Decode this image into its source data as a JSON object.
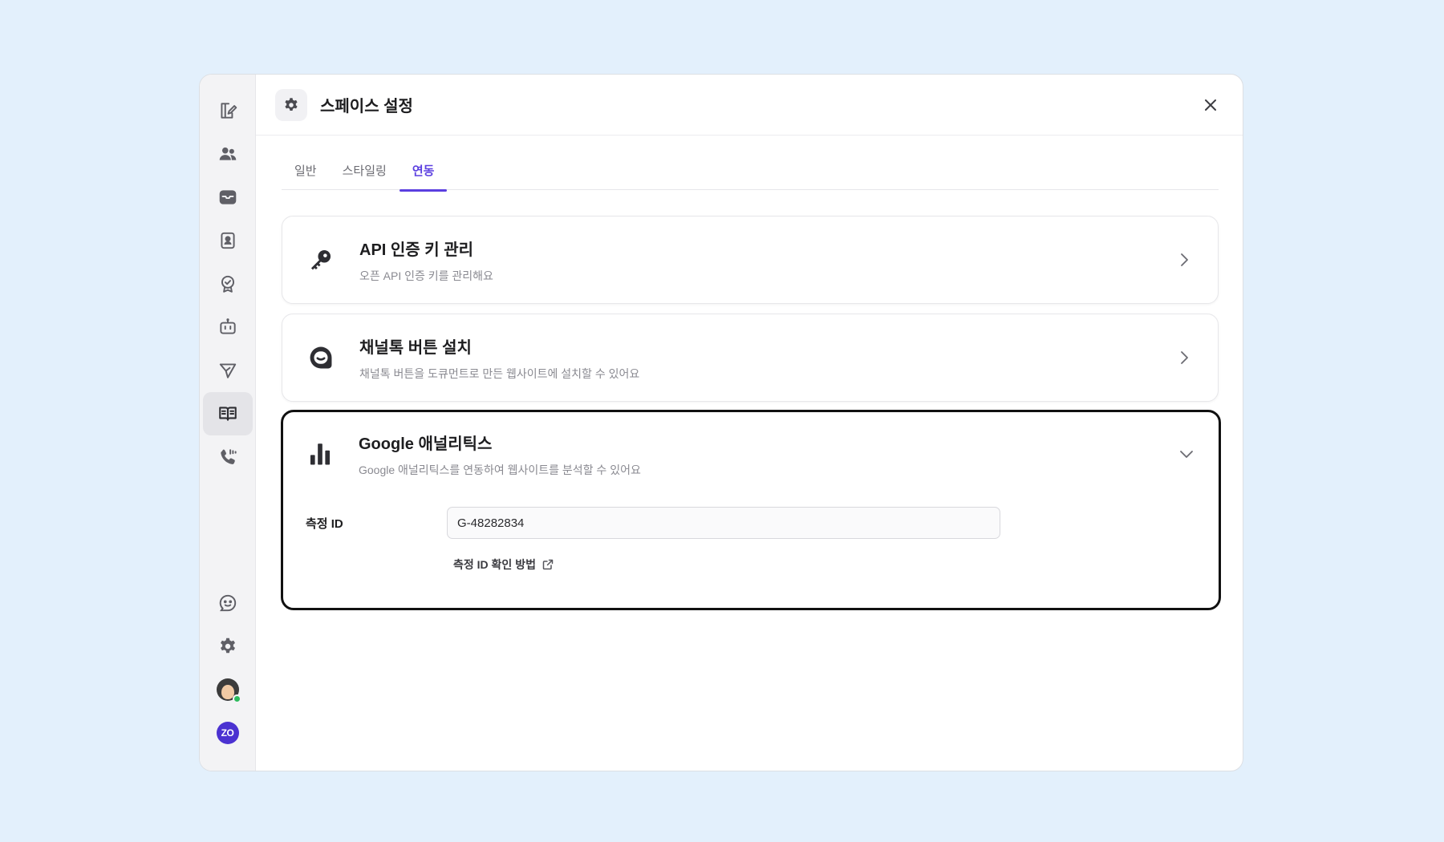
{
  "sidebar": {
    "top_items": [
      {
        "icon": "compose-icon"
      },
      {
        "icon": "users-icon"
      },
      {
        "icon": "inbox-icon"
      },
      {
        "icon": "contacts-icon"
      },
      {
        "icon": "badge-icon"
      },
      {
        "icon": "bot-icon"
      },
      {
        "icon": "send-icon"
      },
      {
        "icon": "book-icon",
        "active": true
      },
      {
        "icon": "phone-icon"
      }
    ],
    "bottom_items": [
      {
        "icon": "smiley-chat-icon"
      },
      {
        "icon": "gear-icon"
      },
      {
        "icon": "avatar"
      },
      {
        "icon": "workspace-logo",
        "label": "ZO"
      }
    ]
  },
  "header": {
    "title": "스페이스 설정"
  },
  "tabs": [
    {
      "label": "일반",
      "active": false
    },
    {
      "label": "스타일링",
      "active": false
    },
    {
      "label": "연동",
      "active": true
    }
  ],
  "cards": {
    "api": {
      "title": "API 인증 키 관리",
      "description": "오픈 API 인증 키를 관리해요"
    },
    "channeltalk": {
      "title": "채널톡 버튼 설치",
      "description": "채널톡 버튼을 도큐먼트로 만든 웹사이트에 설치할 수 있어요"
    },
    "google_analytics": {
      "title": "Google 애널리틱스",
      "description": "Google 애널리틱스를 연동하여 웹사이트를 분석할 수 있어요",
      "field_label": "측정 ID",
      "field_value": "G-48282834",
      "help_link": "측정 ID 확인 방법"
    }
  },
  "colors": {
    "background": "#e3f0fc",
    "accent": "#5b3fe0",
    "online": "#2dbb5d",
    "workspace_badge": "#4b32d1"
  }
}
